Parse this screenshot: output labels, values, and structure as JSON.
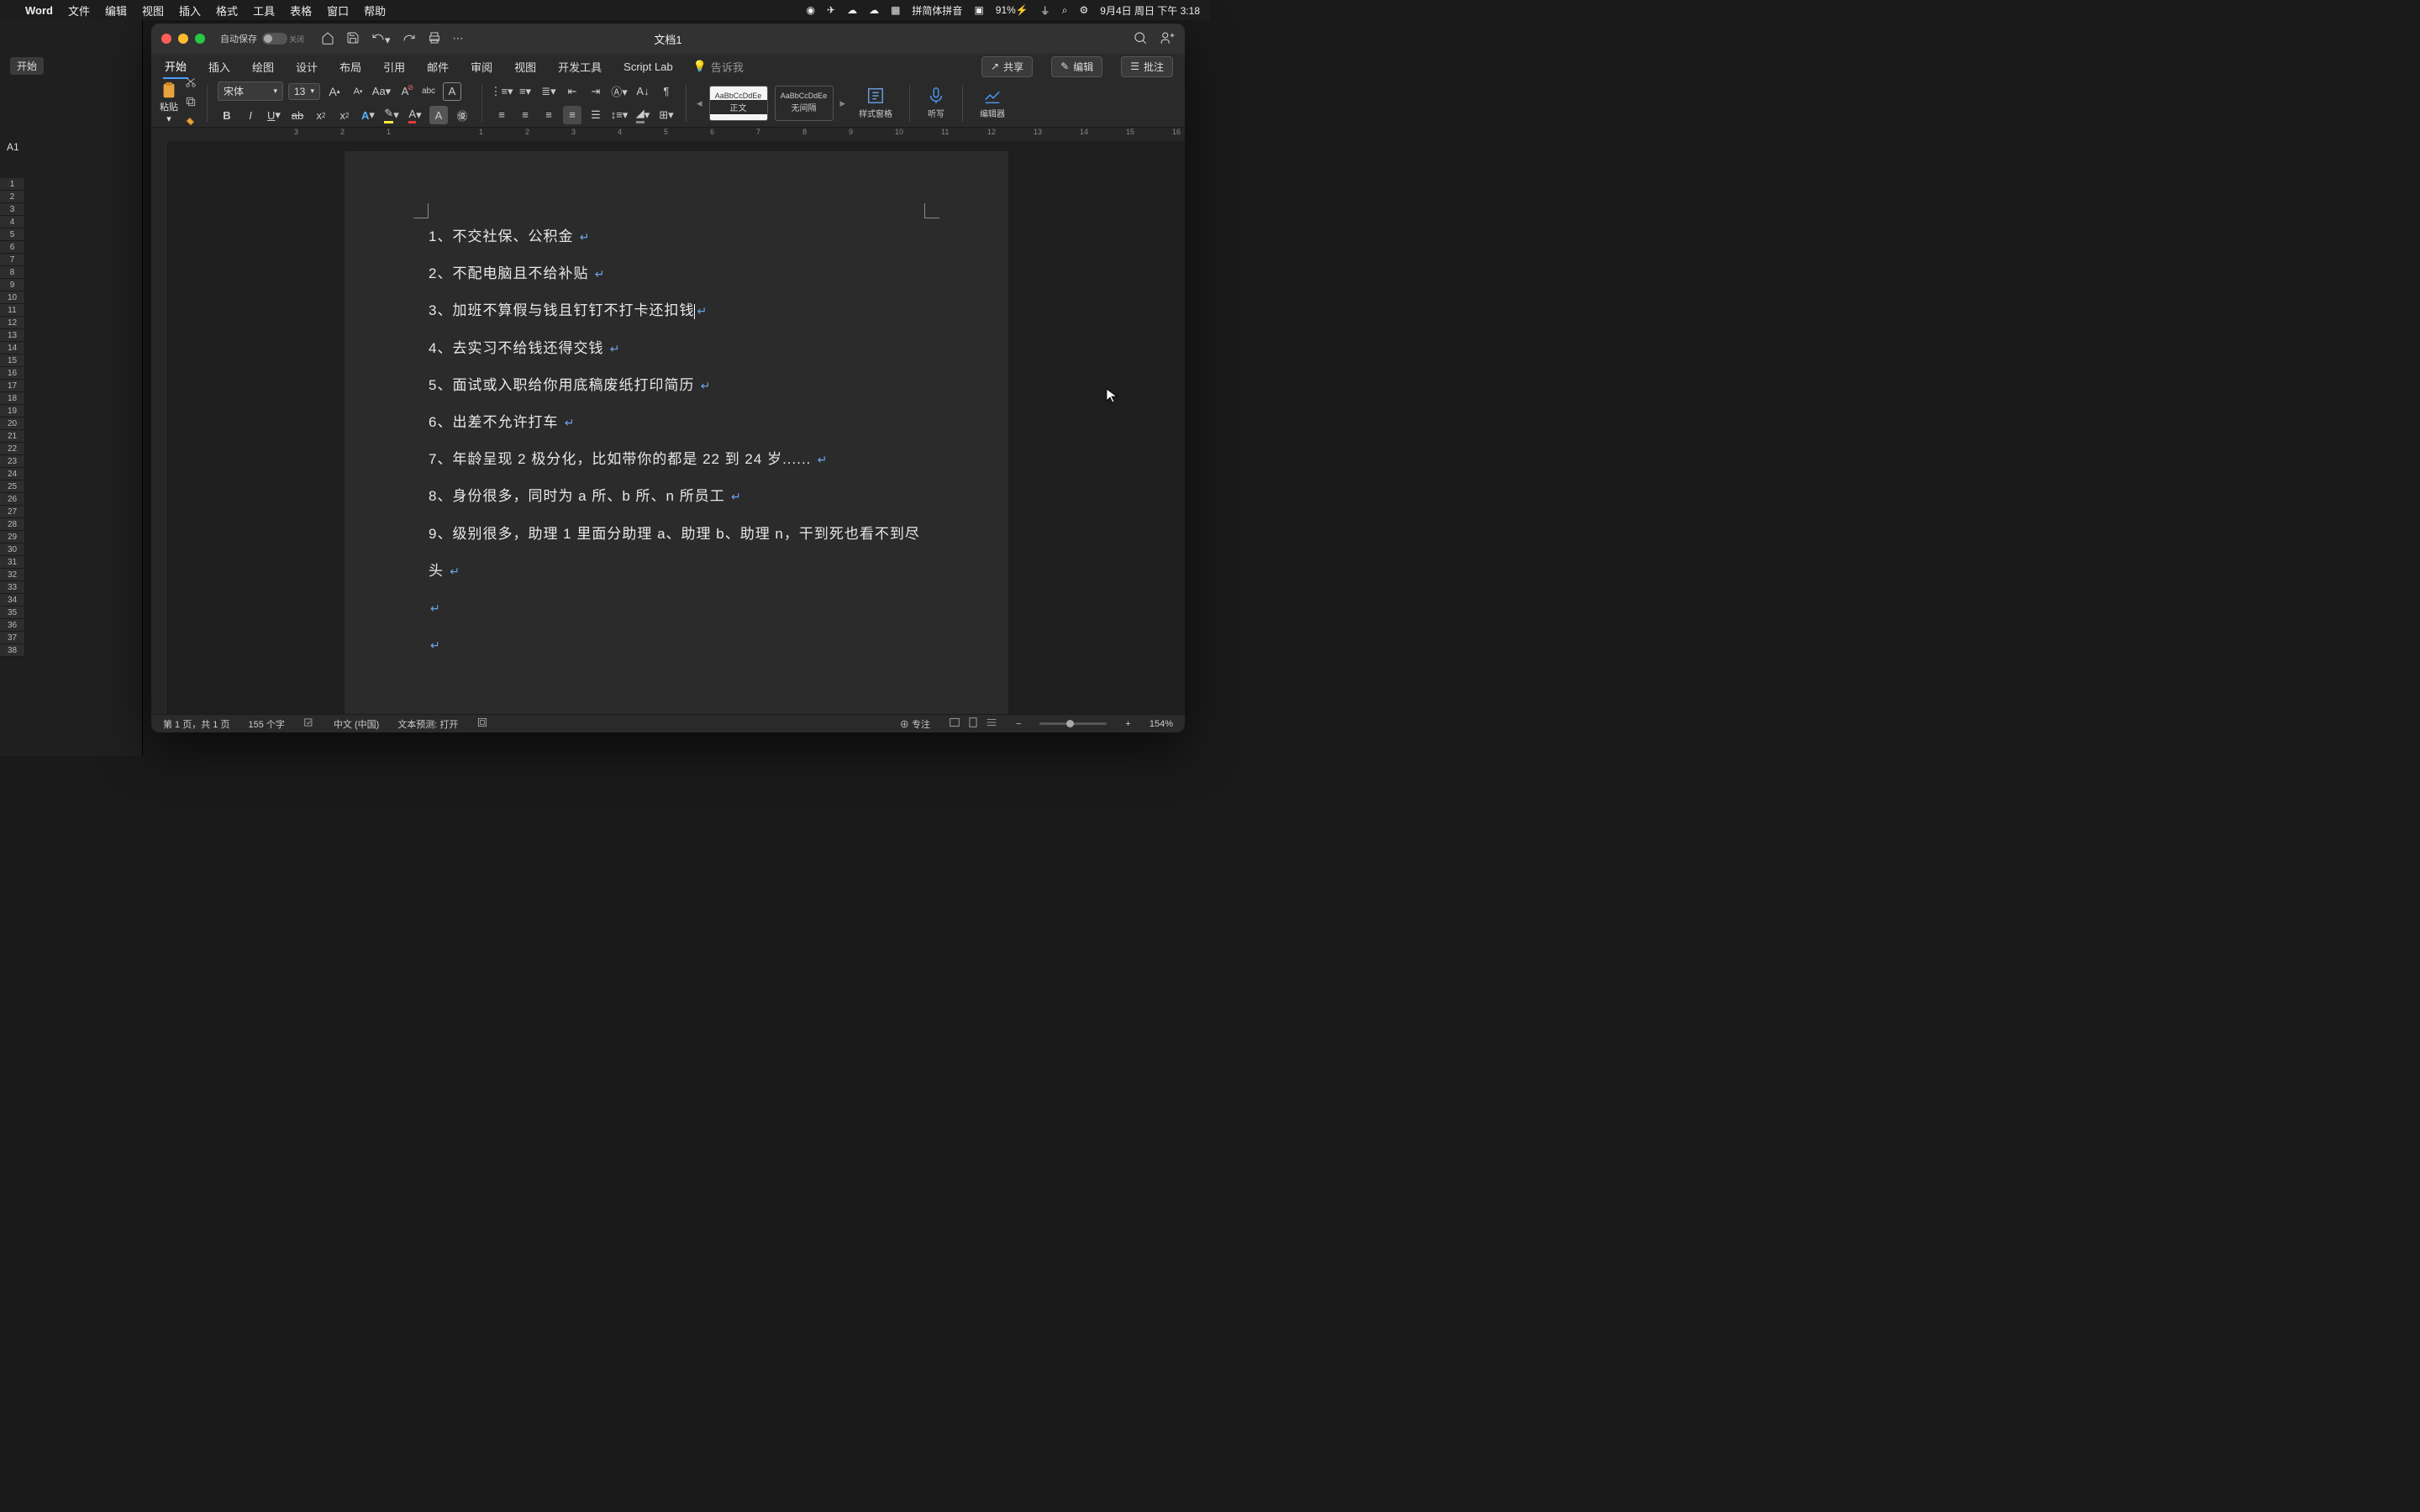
{
  "menubar": {
    "app": "Word",
    "items": [
      "文件",
      "编辑",
      "视图",
      "插入",
      "格式",
      "工具",
      "表格",
      "窗口",
      "帮助"
    ],
    "ime": "简体拼音",
    "battery": "91%",
    "datetime": "9月4日 周日 下午 3:18"
  },
  "excel": {
    "cell_ref": "A1",
    "tab1": "开始"
  },
  "titlebar": {
    "autosave": "自动保存",
    "autosave_state": "关闭",
    "doc": "文档1"
  },
  "tabs": {
    "items": [
      "开始",
      "插入",
      "绘图",
      "设计",
      "布局",
      "引用",
      "邮件",
      "审阅",
      "视图",
      "开发工具",
      "Script Lab"
    ],
    "tell_me": "告诉我",
    "share": "共享",
    "edit": "编辑",
    "comment": "批注"
  },
  "ribbon": {
    "paste": "粘贴",
    "font": "宋体",
    "size": "13",
    "style1_preview": "AaBbCcDdEe",
    "style1_name": "正文",
    "style2_preview": "AaBbCcDdEe",
    "style2_name": "无间隔",
    "pane": "样式窗格",
    "dictate": "听写",
    "editor": "编辑器"
  },
  "ruler_ticks": [
    "3",
    "2",
    "1",
    "",
    "1",
    "2",
    "3",
    "4",
    "5",
    "6",
    "7",
    "8",
    "9",
    "10",
    "11",
    "12",
    "13",
    "14",
    "15",
    "16"
  ],
  "doc": {
    "lines": [
      "1、不交社保、公积金",
      "2、不配电脑且不给补贴",
      "3、加班不算假与钱且钉钉不打卡还扣钱",
      "4、去实习不给钱还得交钱",
      "5、面试或入职给你用底稿废纸打印简历",
      "6、出差不允许打车",
      "7、年龄呈现 2 极分化，比如带你的都是 22 到 24 岁......",
      "8、身份很多，同时为 a 所、b 所、n 所员工",
      "9、级别很多，助理 1 里面分助理 a、助理 b、助理 n，干到死也看不到尽头"
    ]
  },
  "status": {
    "page": "第 1 页，共 1 页",
    "words": "155 个字",
    "lang": "中文 (中国)",
    "predict": "文本预测: 打开",
    "focus": "专注",
    "zoom": "154%"
  }
}
